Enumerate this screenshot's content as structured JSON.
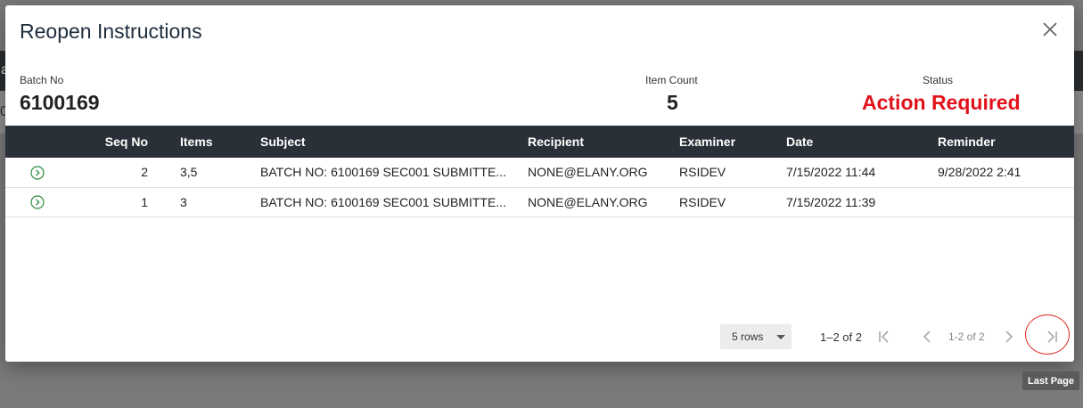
{
  "modal": {
    "title": "Reopen Instructions"
  },
  "summary": {
    "batch_no_label": "Batch No",
    "batch_no_value": "6100169",
    "item_count_label": "Item Count",
    "item_count_value": "5",
    "status_label": "Status",
    "status_value": "Action Required",
    "status_color": "#e0121a"
  },
  "table": {
    "columns": [
      "",
      "Seq No",
      "Items",
      "Subject",
      "Recipient",
      "Examiner",
      "Date",
      "Reminder"
    ],
    "rows": [
      {
        "seq_no": "2",
        "items": "3,5",
        "subject": "BATCH NO: 6100169 SEC001 SUBMITTE...",
        "recipient": "NONE@ELANY.ORG",
        "examiner": "RSIDEV",
        "date": "7/15/2022 11:44",
        "reminder": "9/28/2022 2:41"
      },
      {
        "seq_no": "1",
        "items": "3",
        "subject": "BATCH NO: 6100169 SEC001 SUBMITTE...",
        "recipient": "NONE@ELANY.ORG",
        "examiner": "RSIDEV",
        "date": "7/15/2022 11:39",
        "reminder": ""
      }
    ]
  },
  "pagination": {
    "rows_per_page": "5 rows",
    "range": "1–2 of 2",
    "page_info": "1-2 of 2",
    "tooltip": "Last Page"
  },
  "background": {
    "letter_a": "a",
    "letter_0": "0"
  },
  "colors": {
    "header_bg": "#2a3037",
    "accent_green": "#2e8b3e",
    "highlight_red": "#d9261c"
  },
  "icons": {
    "close": "close-icon",
    "row_open": "chevron-circle-right-icon",
    "first_page": "first-page-icon",
    "prev_page": "prev-page-icon",
    "next_page": "next-page-icon",
    "last_page": "last-page-icon"
  }
}
